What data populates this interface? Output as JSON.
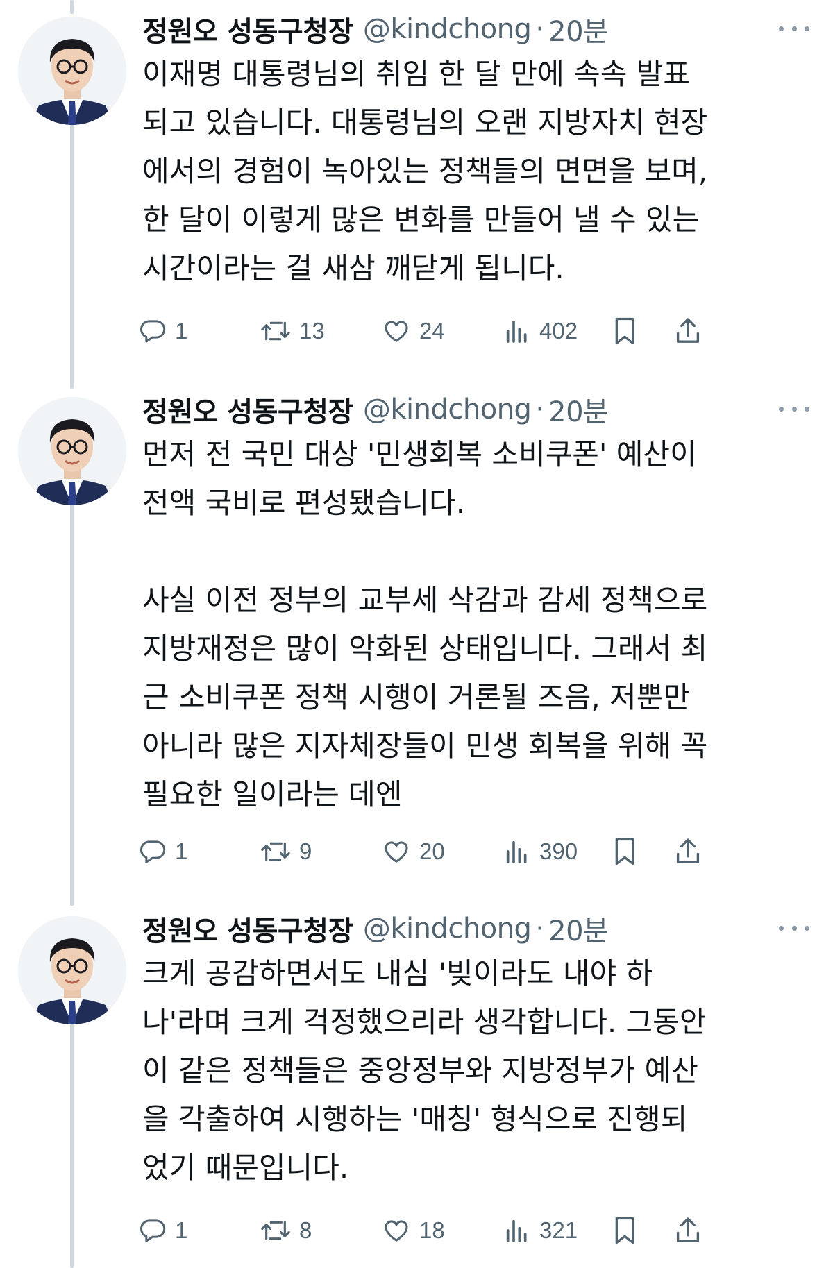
{
  "tweets": [
    {
      "author": {
        "display_name": "정원오 성동구청장",
        "handle": "@kindchong",
        "time": "20분"
      },
      "lines": [
        "이재명 대통령님의 취임 한 달 만에 속속 발표",
        "되고 있습니다. 대통령님의 오랜 지방자치 현장",
        "에서의 경험이 녹아있는 정책들의 면면을 보며,",
        "한 달이 이렇게 많은 변화를 만들어 낼 수 있는",
        "시간이라는 걸 새삼 깨닫게 됩니다."
      ],
      "stats": {
        "replies": "1",
        "reposts": "13",
        "likes": "24",
        "views": "402"
      }
    },
    {
      "author": {
        "display_name": "정원오 성동구청장",
        "handle": "@kindchong",
        "time": "20분"
      },
      "lines": [
        "먼저 전 국민 대상 '민생회복 소비쿠폰' 예산이",
        "전액 국비로 편성됐습니다.",
        "",
        "사실 이전 정부의 교부세 삭감과 감세 정책으로",
        "지방재정은 많이 악화된 상태입니다. 그래서 최",
        "근 소비쿠폰 정책 시행이 거론될 즈음, 저뿐만",
        "아니라 많은 지자체장들이 민생 회복을 위해 꼭",
        "필요한 일이라는 데엔"
      ],
      "stats": {
        "replies": "1",
        "reposts": "9",
        "likes": "20",
        "views": "390"
      }
    },
    {
      "author": {
        "display_name": "정원오 성동구청장",
        "handle": "@kindchong",
        "time": "20분"
      },
      "lines": [
        "크게 공감하면서도 내심 '빚이라도 내야 하",
        "나'라며 크게 걱정했으리라 생각합니다. 그동안",
        "이 같은 정책들은 중앙정부와 지방정부가 예산",
        "을 각출하여 시행하는 '매칭' 형식으로 진행되",
        "었기 때문입니다."
      ],
      "stats": {
        "replies": "1",
        "reposts": "8",
        "likes": "18",
        "views": "321"
      }
    }
  ],
  "icons": {
    "reply": "reply-icon",
    "repost": "repost-icon",
    "like": "heart-icon",
    "views": "views-icon",
    "bookmark": "bookmark-icon",
    "share": "share-icon",
    "more": "more-dots-icon"
  },
  "colors": {
    "text": "#0f1419",
    "secondary": "#536471",
    "thread_line": "#cfd9de",
    "background": "#ffffff"
  }
}
